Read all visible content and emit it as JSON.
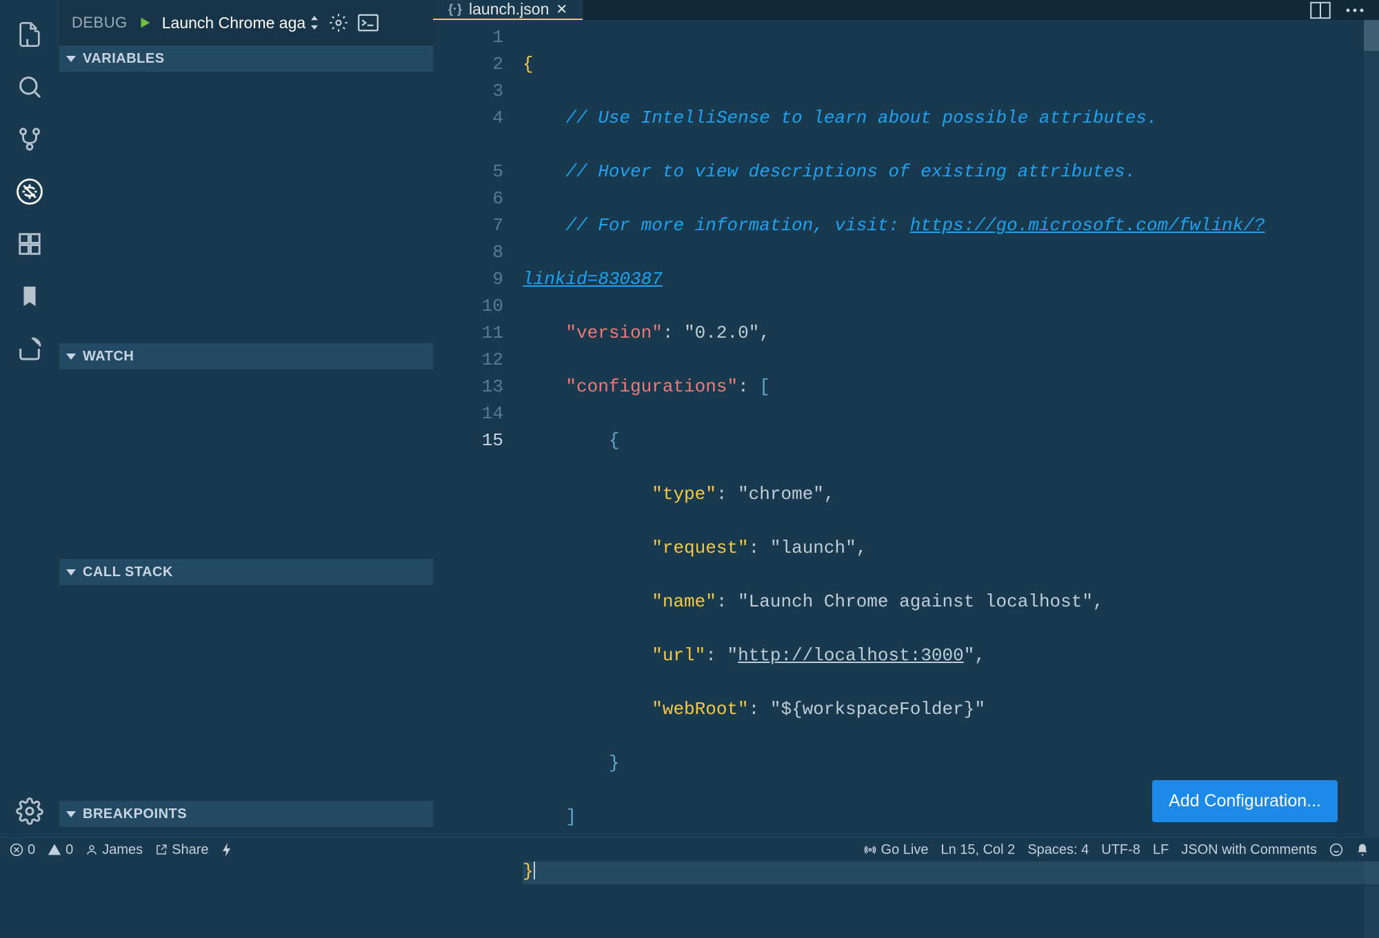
{
  "debug_header": {
    "label": "DEBUG",
    "config": "Launch Chrome aga"
  },
  "sections": {
    "variables": "VARIABLES",
    "watch": "WATCH",
    "callstack": "CALL STACK",
    "breakpoints": "BREAKPOINTS"
  },
  "tab": {
    "filename": "launch.json"
  },
  "editor": {
    "lines": [
      "1",
      "2",
      "3",
      "4",
      "5",
      "6",
      "7",
      "8",
      "9",
      "10",
      "11",
      "12",
      "13",
      "14",
      "15"
    ],
    "comment1": "// Use IntelliSense to learn about possible attributes.",
    "comment2": "// Hover to view descriptions of existing attributes.",
    "comment3a": "// For more information, visit: ",
    "comment3b": "https://go.microsoft.com/fwlink/?",
    "comment3c": "linkid=830387",
    "version_key": "\"version\"",
    "version_val": "\"0.2.0\"",
    "configs_key": "\"configurations\"",
    "type_key": "\"type\"",
    "type_val": "\"chrome\"",
    "request_key": "\"request\"",
    "request_val": "\"launch\"",
    "name_key": "\"name\"",
    "name_val": "\"Launch Chrome against localhost\"",
    "url_key": "\"url\"",
    "url_val_q1": "\"",
    "url_val_link": "http://localhost:3000",
    "url_val_q2": "\"",
    "webroot_key": "\"webRoot\"",
    "webroot_val": "\"${workspaceFolder}\""
  },
  "button": {
    "add_config": "Add Configuration..."
  },
  "status": {
    "errors": "0",
    "warnings": "0",
    "user": "James",
    "share": "Share",
    "golive": "Go Live",
    "position": "Ln 15, Col 2",
    "spaces": "Spaces: 4",
    "encoding": "UTF-8",
    "eol": "LF",
    "lang": "JSON with Comments"
  }
}
